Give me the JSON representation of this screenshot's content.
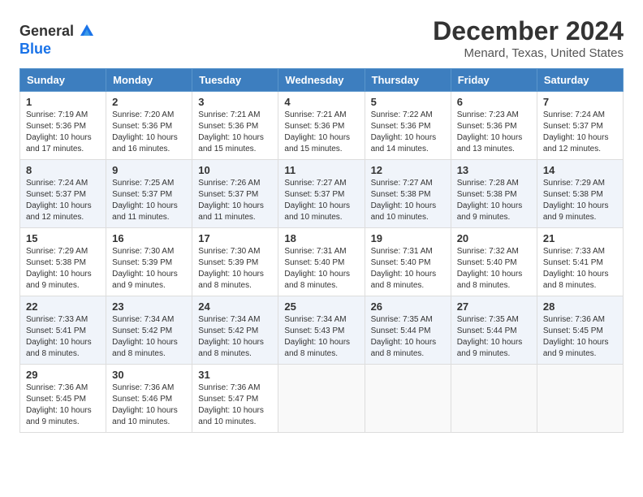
{
  "header": {
    "logo_general": "General",
    "logo_blue": "Blue",
    "title": "December 2024",
    "subtitle": "Menard, Texas, United States"
  },
  "days_of_week": [
    "Sunday",
    "Monday",
    "Tuesday",
    "Wednesday",
    "Thursday",
    "Friday",
    "Saturday"
  ],
  "weeks": [
    [
      {
        "day": "1",
        "info": "Sunrise: 7:19 AM\nSunset: 5:36 PM\nDaylight: 10 hours and 17 minutes."
      },
      {
        "day": "2",
        "info": "Sunrise: 7:20 AM\nSunset: 5:36 PM\nDaylight: 10 hours and 16 minutes."
      },
      {
        "day": "3",
        "info": "Sunrise: 7:21 AM\nSunset: 5:36 PM\nDaylight: 10 hours and 15 minutes."
      },
      {
        "day": "4",
        "info": "Sunrise: 7:21 AM\nSunset: 5:36 PM\nDaylight: 10 hours and 15 minutes."
      },
      {
        "day": "5",
        "info": "Sunrise: 7:22 AM\nSunset: 5:36 PM\nDaylight: 10 hours and 14 minutes."
      },
      {
        "day": "6",
        "info": "Sunrise: 7:23 AM\nSunset: 5:36 PM\nDaylight: 10 hours and 13 minutes."
      },
      {
        "day": "7",
        "info": "Sunrise: 7:24 AM\nSunset: 5:37 PM\nDaylight: 10 hours and 12 minutes."
      }
    ],
    [
      {
        "day": "8",
        "info": "Sunrise: 7:24 AM\nSunset: 5:37 PM\nDaylight: 10 hours and 12 minutes."
      },
      {
        "day": "9",
        "info": "Sunrise: 7:25 AM\nSunset: 5:37 PM\nDaylight: 10 hours and 11 minutes."
      },
      {
        "day": "10",
        "info": "Sunrise: 7:26 AM\nSunset: 5:37 PM\nDaylight: 10 hours and 11 minutes."
      },
      {
        "day": "11",
        "info": "Sunrise: 7:27 AM\nSunset: 5:37 PM\nDaylight: 10 hours and 10 minutes."
      },
      {
        "day": "12",
        "info": "Sunrise: 7:27 AM\nSunset: 5:38 PM\nDaylight: 10 hours and 10 minutes."
      },
      {
        "day": "13",
        "info": "Sunrise: 7:28 AM\nSunset: 5:38 PM\nDaylight: 10 hours and 9 minutes."
      },
      {
        "day": "14",
        "info": "Sunrise: 7:29 AM\nSunset: 5:38 PM\nDaylight: 10 hours and 9 minutes."
      }
    ],
    [
      {
        "day": "15",
        "info": "Sunrise: 7:29 AM\nSunset: 5:38 PM\nDaylight: 10 hours and 9 minutes."
      },
      {
        "day": "16",
        "info": "Sunrise: 7:30 AM\nSunset: 5:39 PM\nDaylight: 10 hours and 9 minutes."
      },
      {
        "day": "17",
        "info": "Sunrise: 7:30 AM\nSunset: 5:39 PM\nDaylight: 10 hours and 8 minutes."
      },
      {
        "day": "18",
        "info": "Sunrise: 7:31 AM\nSunset: 5:40 PM\nDaylight: 10 hours and 8 minutes."
      },
      {
        "day": "19",
        "info": "Sunrise: 7:31 AM\nSunset: 5:40 PM\nDaylight: 10 hours and 8 minutes."
      },
      {
        "day": "20",
        "info": "Sunrise: 7:32 AM\nSunset: 5:40 PM\nDaylight: 10 hours and 8 minutes."
      },
      {
        "day": "21",
        "info": "Sunrise: 7:33 AM\nSunset: 5:41 PM\nDaylight: 10 hours and 8 minutes."
      }
    ],
    [
      {
        "day": "22",
        "info": "Sunrise: 7:33 AM\nSunset: 5:41 PM\nDaylight: 10 hours and 8 minutes."
      },
      {
        "day": "23",
        "info": "Sunrise: 7:34 AM\nSunset: 5:42 PM\nDaylight: 10 hours and 8 minutes."
      },
      {
        "day": "24",
        "info": "Sunrise: 7:34 AM\nSunset: 5:42 PM\nDaylight: 10 hours and 8 minutes."
      },
      {
        "day": "25",
        "info": "Sunrise: 7:34 AM\nSunset: 5:43 PM\nDaylight: 10 hours and 8 minutes."
      },
      {
        "day": "26",
        "info": "Sunrise: 7:35 AM\nSunset: 5:44 PM\nDaylight: 10 hours and 8 minutes."
      },
      {
        "day": "27",
        "info": "Sunrise: 7:35 AM\nSunset: 5:44 PM\nDaylight: 10 hours and 9 minutes."
      },
      {
        "day": "28",
        "info": "Sunrise: 7:36 AM\nSunset: 5:45 PM\nDaylight: 10 hours and 9 minutes."
      }
    ],
    [
      {
        "day": "29",
        "info": "Sunrise: 7:36 AM\nSunset: 5:45 PM\nDaylight: 10 hours and 9 minutes."
      },
      {
        "day": "30",
        "info": "Sunrise: 7:36 AM\nSunset: 5:46 PM\nDaylight: 10 hours and 10 minutes."
      },
      {
        "day": "31",
        "info": "Sunrise: 7:36 AM\nSunset: 5:47 PM\nDaylight: 10 hours and 10 minutes."
      },
      {
        "day": "",
        "info": ""
      },
      {
        "day": "",
        "info": ""
      },
      {
        "day": "",
        "info": ""
      },
      {
        "day": "",
        "info": ""
      }
    ]
  ]
}
